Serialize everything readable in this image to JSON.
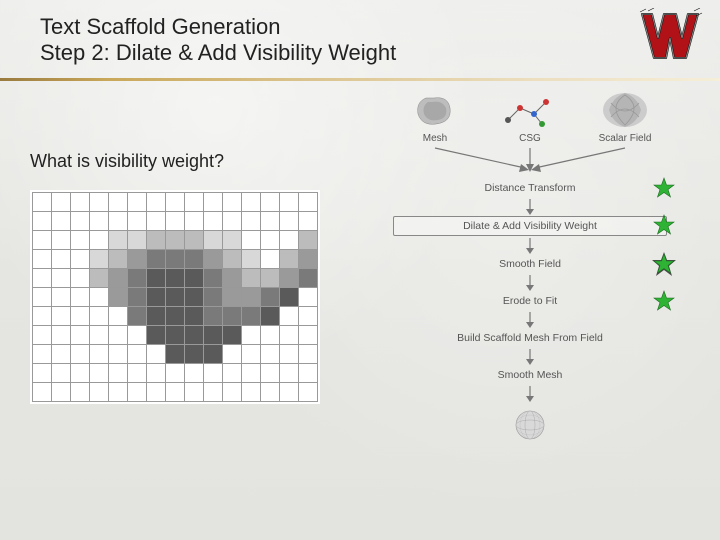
{
  "header": {
    "line1": "Text Scaffold Generation",
    "line2": "Step 2: Dilate & Add Visibility Weight"
  },
  "question": "What is visibility weight?",
  "inputs": [
    {
      "label": "Mesh"
    },
    {
      "label": "CSG"
    },
    {
      "label": "Scalar Field"
    }
  ],
  "steps": [
    {
      "label": "Distance Transform",
      "boxed": false,
      "star": true,
      "darkStar": false
    },
    {
      "label": "Dilate & Add Visibility Weight",
      "boxed": true,
      "star": true,
      "darkStar": false
    },
    {
      "label": "Smooth Field",
      "boxed": false,
      "star": true,
      "darkStar": true
    },
    {
      "label": "Erode to Fit",
      "boxed": false,
      "star": true,
      "darkStar": false
    },
    {
      "label": "Build Scaffold Mesh From Field",
      "boxed": false,
      "star": false,
      "darkStar": false
    },
    {
      "label": "Smooth Mesh",
      "boxed": false,
      "star": false,
      "darkStar": false
    }
  ],
  "grid": {
    "cols": 15,
    "rows": 11,
    "pattern": [
      "...............",
      "...............",
      "....aabbbaa...b",
      "...abcdddcba.bc",
      "...bcdeeedcbbcd",
      "....cdeeedccde.",
      ".....deeeddde..",
      "......eeeee....",
      ".......eee.....",
      "...............",
      "..............."
    ],
    "shades": {
      ".": "#ffffff",
      "a": "#d8d8d8",
      "b": "#bcbcbc",
      "c": "#9a9a9a",
      "d": "#7a7a7a",
      "e": "#5a5a5a"
    }
  },
  "colors": {
    "starFill": "#2fb335",
    "starDarkBg": "#4a4a4a"
  }
}
